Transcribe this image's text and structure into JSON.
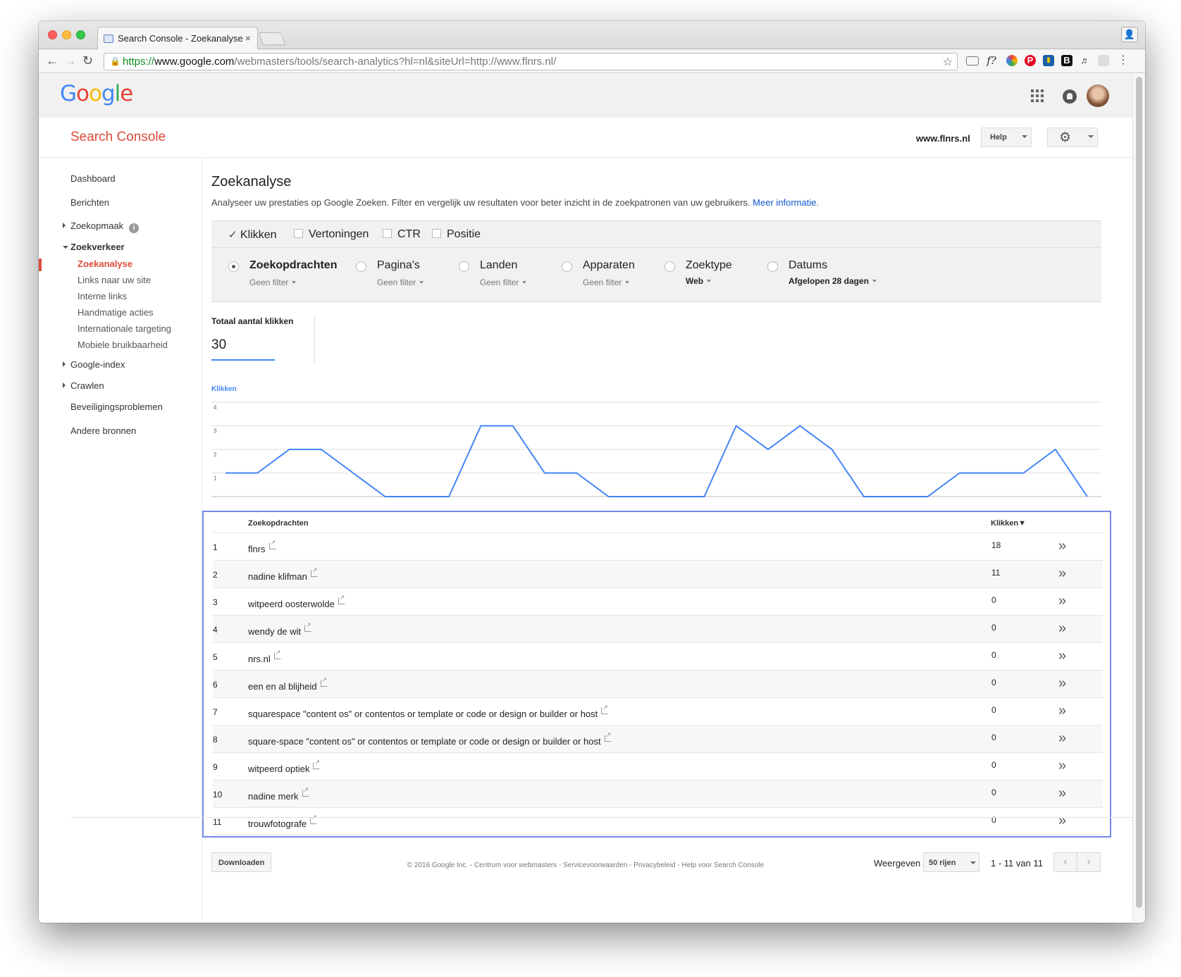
{
  "browser": {
    "tab_title": "Search Console - Zoekanalyse",
    "tab_close": "×",
    "url_scheme": "https://",
    "url_host": "www.google.com",
    "url_path": "/webmasters/tools/search-analytics?hl=nl&siteUrl=http://www.flnrs.nl/",
    "back": "←",
    "forward": "→",
    "reload": "↻",
    "star": "☆",
    "menu": "⋮"
  },
  "google_logo": [
    "G",
    "o",
    "o",
    "g",
    "l",
    "e"
  ],
  "header": {
    "product_title": "Search Console",
    "site": "www.flnrs.nl",
    "help_label": "Help"
  },
  "sidebar": {
    "items": [
      {
        "label": "Dashboard"
      },
      {
        "label": "Berichten"
      },
      {
        "label": "Zoekopmaak"
      },
      {
        "label": "Zoekverkeer"
      },
      {
        "label": "Zoekanalyse"
      },
      {
        "label": "Links naar uw site"
      },
      {
        "label": "Interne links"
      },
      {
        "label": "Handmatige acties"
      },
      {
        "label": "Internationale targeting"
      },
      {
        "label": "Mobiele bruikbaarheid"
      },
      {
        "label": "Google-index"
      },
      {
        "label": "Crawlen"
      },
      {
        "label": "Beveiligingsproblemen"
      },
      {
        "label": "Andere bronnen"
      }
    ]
  },
  "main": {
    "title": "Zoekanalyse",
    "description": "Analyseer uw prestaties op Google Zoeken. Filter en vergelijk uw resultaten voor beter inzicht in de zoekpatronen van uw gebruikers.",
    "more_info_link": "Meer informatie.",
    "metrics": [
      {
        "label": "Klikken",
        "checked": true
      },
      {
        "label": "Vertoningen",
        "checked": false
      },
      {
        "label": "CTR",
        "checked": false
      },
      {
        "label": "Positie",
        "checked": false
      }
    ],
    "dimensions": [
      {
        "label": "Zoekopdrachten",
        "filter": "Geen filter",
        "selected": true
      },
      {
        "label": "Pagina's",
        "filter": "Geen filter",
        "selected": false
      },
      {
        "label": "Landen",
        "filter": "Geen filter",
        "selected": false
      },
      {
        "label": "Apparaten",
        "filter": "Geen filter",
        "selected": false
      },
      {
        "label": "Zoektype",
        "filter": "Web",
        "selected": false
      },
      {
        "label": "Datums",
        "filter": "Afgelopen 28 dagen",
        "selected": false
      }
    ],
    "total": {
      "label": "Totaal aantal klikken",
      "value": "30"
    }
  },
  "chart_data": {
    "type": "line",
    "series": [
      {
        "name": "Klikken",
        "color": "#4285f4",
        "values": [
          1,
          1,
          2,
          2,
          1,
          0,
          0,
          0,
          3,
          3,
          1,
          1,
          0,
          0,
          0,
          0,
          3,
          2,
          3,
          2,
          0,
          0,
          0,
          1,
          1,
          1,
          2,
          0
        ]
      }
    ],
    "ylim": [
      0,
      4
    ],
    "yticks": [
      "4",
      "3",
      "2",
      "1"
    ],
    "grid": true
  },
  "table": {
    "header_query": "Zoekopdrachten",
    "header_clicks": "Klikken▼",
    "rows": [
      {
        "idx": "1",
        "query": "flnrs",
        "clicks": "18"
      },
      {
        "idx": "2",
        "query": "nadine klifman",
        "clicks": "11"
      },
      {
        "idx": "3",
        "query": "witpeerd oosterwolde",
        "clicks": "0"
      },
      {
        "idx": "4",
        "query": "wendy de wit",
        "clicks": "0"
      },
      {
        "idx": "5",
        "query": "nrs.nl",
        "clicks": "0"
      },
      {
        "idx": "6",
        "query": "een en al blijheid",
        "clicks": "0"
      },
      {
        "idx": "7",
        "query": "squarespace \"content os\" or contentos or template or code or design or builder or host",
        "clicks": "0"
      },
      {
        "idx": "8",
        "query": "square-space \"content os\" or contentos or template or code or design or builder or host",
        "clicks": "0"
      },
      {
        "idx": "9",
        "query": "witpeerd optiek",
        "clicks": "0"
      },
      {
        "idx": "10",
        "query": "nadine merk",
        "clicks": "0"
      },
      {
        "idx": "11",
        "query": "trouwfotografe",
        "clicks": "0"
      }
    ]
  },
  "footer": {
    "download_label": "Downloaden",
    "show_label": "Weergeven",
    "rows_option": "50 rijen",
    "range": "1 - 11 van 11",
    "prev": "‹",
    "next": "›",
    "copyright": "© 2016 Google Inc. - Centrum voor webmasters - Servicevoorwaarden - Privacybeleid - Help voor Search Console"
  }
}
